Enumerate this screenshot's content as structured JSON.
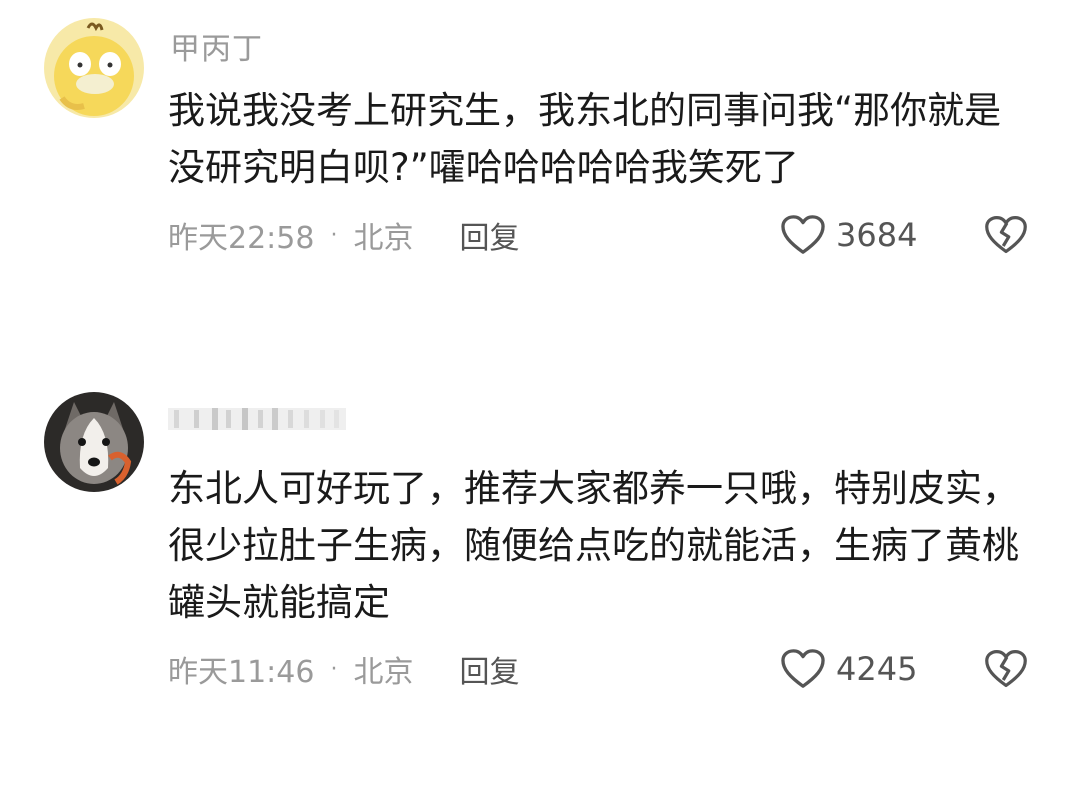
{
  "comments": [
    {
      "username": "甲丙丁",
      "text": "我说我没考上研究生，我东北的同事问我“那你就是没研究明白呗?”嚯哈哈哈哈哈我笑死了",
      "time": "昨天22:58",
      "separator": "·",
      "location": "北京",
      "reply_label": "回复",
      "likes": "3684",
      "avatar_icon": "yellow-duck-avatar",
      "like_icon": "heart-outline-icon",
      "dislike_icon": "broken-heart-icon"
    },
    {
      "username": "",
      "text": "东北人可好玩了，推荐大家都养一只哦，特别皮实，很少拉肚子生病，随便给点吃的就能活，生病了黄桃罐头就能搞定",
      "time": "昨天11:46",
      "separator": "·",
      "location": "北京",
      "reply_label": "回复",
      "likes": "4245",
      "avatar_icon": "husky-dog-avatar",
      "like_icon": "heart-outline-icon",
      "dislike_icon": "broken-heart-icon"
    }
  ],
  "colors": {
    "background": "#ffffff",
    "body_text": "#1a1a1a",
    "meta_text": "#9a9a9a",
    "icon": "#555555"
  }
}
